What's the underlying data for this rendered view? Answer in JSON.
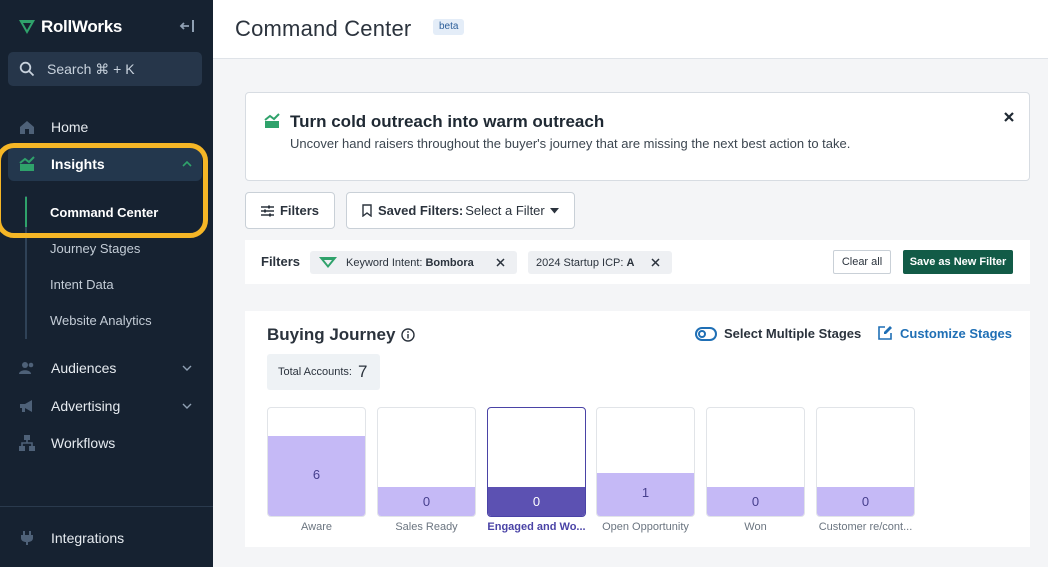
{
  "sidebar": {
    "brand": "RollWorks",
    "search_placeholder": "Search ⌘ + K",
    "nav": {
      "home": "Home",
      "insights": "Insights",
      "audiences": "Audiences",
      "advertising": "Advertising",
      "workflows": "Workflows",
      "integrations": "Integrations"
    },
    "insights_sub": {
      "command_center": "Command Center",
      "journey_stages": "Journey Stages",
      "intent_data": "Intent Data",
      "website_analytics": "Website Analytics"
    }
  },
  "header": {
    "title": "Command Center",
    "badge": "beta"
  },
  "banner": {
    "title": "Turn cold outreach into warm outreach",
    "text": "Uncover hand raisers throughout the buyer's journey that are missing the next best action to take."
  },
  "toolbar": {
    "filters_label": "Filters",
    "saved_filters_label": "Saved Filters:",
    "saved_filters_value": "Select a Filter"
  },
  "filter_bar": {
    "label": "Filters",
    "chips": [
      {
        "key": "Keyword Intent:",
        "value": "Bombora"
      },
      {
        "key": "2024 Startup ICP:",
        "value": "A"
      }
    ],
    "clear_all": "Clear all",
    "save_new": "Save as New Filter"
  },
  "buying_journey": {
    "title": "Buying Journey",
    "select_multiple": "Select Multiple Stages",
    "customize": "Customize Stages",
    "total_label": "Total Accounts:",
    "total_value": "7",
    "stages": [
      {
        "label": "Aware",
        "count": "6",
        "fill_fraction": 0.74
      },
      {
        "label": "Sales Ready",
        "count": "0",
        "fill_fraction": 0.27
      },
      {
        "label": "Engaged and Wo...",
        "count": "0",
        "fill_fraction": 0.27
      },
      {
        "label": "Open Opportunity",
        "count": "1",
        "fill_fraction": 0.4
      },
      {
        "label": "Won",
        "count": "0",
        "fill_fraction": 0.27
      },
      {
        "label": "Customer re/cont...",
        "count": "0",
        "fill_fraction": 0.27
      }
    ]
  },
  "colors": {
    "sidebar_bg": "#162231",
    "brand_green": "#2fa26b",
    "highlight": "#f5b626",
    "stage_fill": "#c5b9f6",
    "stage_selected": "#5c51b2",
    "link_blue": "#1f6fb5",
    "save_button": "#125b47"
  }
}
